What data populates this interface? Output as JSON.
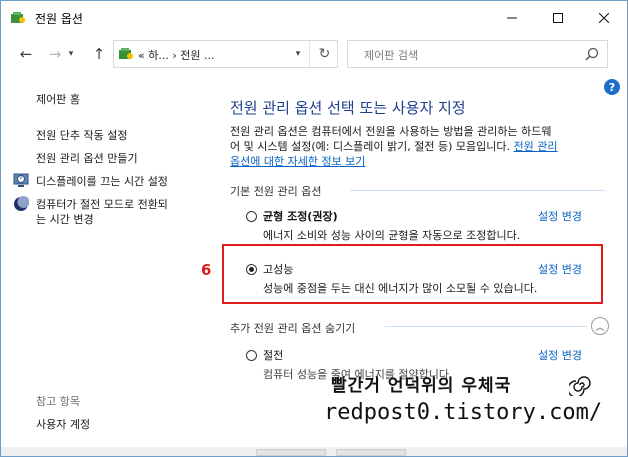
{
  "window": {
    "title": "전원 옵션"
  },
  "address": {
    "crumbs": "« 하... › 전원 ...",
    "path_sep": "›"
  },
  "search": {
    "placeholder": "제어판 검색"
  },
  "left_pane": {
    "home": "제어판 홈",
    "links": [
      "전원 단추 작동 설정",
      "전원 관리 옵션 만들기",
      "디스플레이를 끄는 시간 설정",
      "컴퓨터가 절전 모드로 전환되",
      "는 시간 변경"
    ],
    "see_also": "참고 항목",
    "user_accounts": "사용자 계정"
  },
  "main": {
    "heading": "전원 관리 옵션 선택 또는 사용자 지정",
    "desc_line1": "전원 관리 옵션은 컴퓨터에서 전원을 사용하는 방법을 관리하는 하드웨",
    "desc_line2": "어 및 시스템 설정(예: 디스플레이 밝기, 절전 등) 모음입니다. ",
    "desc_link_a": "전원 관리",
    "desc_link_b": "옵션에 대한 자세한 정보 보기",
    "section_basic": "기본 전원 관리 옵션",
    "plans": [
      {
        "name": "균형 조정(권장)",
        "desc": "에너지 소비와 성능 사이의 균형을 자동으로 조정합니다.",
        "link": "설정 변경",
        "selected": false
      },
      {
        "name": "고성능",
        "desc": "성능에 중점을 두는 대신 에너지가 많이 소모될 수 있습니다.",
        "link": "설정 변경",
        "selected": true
      }
    ],
    "section_extra": "추가 전원 관리 옵션 숨기기",
    "extra_plans": [
      {
        "name": "절전",
        "desc": "컴퓨터 성능을 줄여 에너지를 절약합니다.",
        "link": "설정 변경",
        "selected": false
      }
    ]
  },
  "annotation": {
    "step": "6"
  },
  "watermark": {
    "line1": "빨간거 언덕위의 우체국",
    "line2": "redpost0.tistory.com/"
  },
  "colors": {
    "accent_link": "#0b63c5",
    "heading": "#1e3f8f",
    "highlight_box": "#e01b1b"
  }
}
